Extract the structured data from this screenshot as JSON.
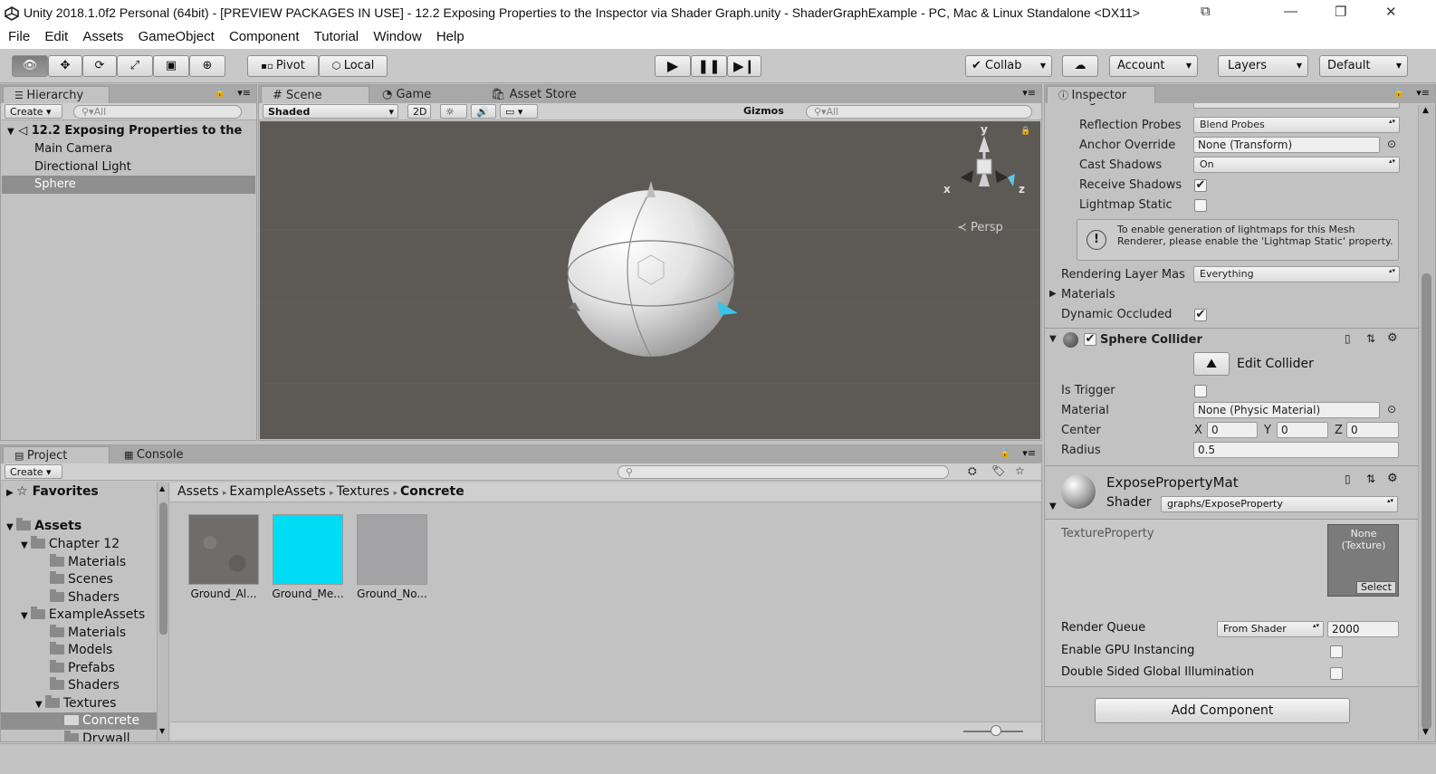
{
  "window": {
    "title": "Unity 2018.1.0f2 Personal (64bit) - [PREVIEW PACKAGES IN USE] - 12.2 Exposing Properties to the Inspector via Shader Graph.unity - ShaderGraphExample - PC, Mac & Linux Standalone <DX11>"
  },
  "menu": [
    "File",
    "Edit",
    "Assets",
    "GameObject",
    "Component",
    "Tutorial",
    "Window",
    "Help"
  ],
  "toolbar": {
    "pivot": "Pivot",
    "local": "Local",
    "collab": "Collab",
    "account": "Account",
    "layers": "Layers",
    "layout": "Default"
  },
  "hierarchy": {
    "tab": "Hierarchy",
    "create": "Create",
    "search_placeholder": "All",
    "scene": "12.2 Exposing Properties to the",
    "items": [
      "Main Camera",
      "Directional Light",
      "Sphere"
    ]
  },
  "scene": {
    "tabs": [
      "Scene",
      "Game",
      "Asset Store"
    ],
    "shading": "Shaded",
    "mode2d": "2D",
    "gizmos": "Gizmos",
    "search_placeholder": "All",
    "persp": "Persp",
    "axes": {
      "x": "x",
      "y": "y",
      "z": "z"
    }
  },
  "inspector": {
    "tab": "Inspector",
    "partial_top": "Light Probes",
    "partial_top_value": "Blend Probes",
    "reflection_probes": {
      "label": "Reflection Probes",
      "value": "Blend Probes"
    },
    "anchor_override": {
      "label": "Anchor Override",
      "value": "None (Transform)"
    },
    "cast_shadows": {
      "label": "Cast Shadows",
      "value": "On"
    },
    "receive_shadows": {
      "label": "Receive Shadows",
      "checked": true
    },
    "lightmap_static": {
      "label": "Lightmap Static",
      "checked": false
    },
    "info_message": "To enable generation of lightmaps for this Mesh Renderer, please enable the 'Lightmap Static' property.",
    "rendering_layer": {
      "label": "Rendering Layer Mas",
      "value": "Everything"
    },
    "materials_label": "Materials",
    "dynamic_occluded": {
      "label": "Dynamic Occluded",
      "checked": true
    },
    "sphere_collider": {
      "title": "Sphere Collider",
      "edit_collider": "Edit Collider",
      "is_trigger": "Is Trigger",
      "material_label": "Material",
      "material_value": "None (Physic Material)",
      "center_label": "Center",
      "center": {
        "x": "0",
        "y": "0",
        "z": "0"
      },
      "radius_label": "Radius",
      "radius": "0.5"
    },
    "material": {
      "name": "ExposePropertyMat",
      "shader_label": "Shader",
      "shader_value": "graphs/ExposeProperty",
      "texture_property": "TextureProperty",
      "texture_none": "None (Texture)",
      "texture_select": "Select",
      "render_queue_label": "Render Queue",
      "render_queue_mode": "From Shader",
      "render_queue_value": "2000",
      "gpu_instancing": "Enable GPU Instancing",
      "double_sided_gi": "Double Sided Global Illumination"
    },
    "add_component": "Add Component"
  },
  "project": {
    "tabs": [
      "Project",
      "Console"
    ],
    "create": "Create",
    "favorites": "Favorites",
    "tree": [
      {
        "label": "Assets",
        "bold": true
      },
      {
        "label": "Chapter 12"
      },
      {
        "label": "Materials"
      },
      {
        "label": "Scenes"
      },
      {
        "label": "Shaders"
      },
      {
        "label": "ExampleAssets"
      },
      {
        "label": "Materials"
      },
      {
        "label": "Models"
      },
      {
        "label": "Prefabs"
      },
      {
        "label": "Shaders"
      },
      {
        "label": "Textures"
      },
      {
        "label": "Concrete"
      },
      {
        "label": "Drywall"
      }
    ],
    "breadcrumb": [
      "Assets",
      "ExampleAssets",
      "Textures",
      "Concrete"
    ],
    "assets": [
      {
        "label": "Ground_Al...",
        "color": "#6f6c69"
      },
      {
        "label": "Ground_Me...",
        "color": "#00dcf4"
      },
      {
        "label": "Ground_No...",
        "color": "#a3a3a6"
      }
    ]
  },
  "colors": {
    "scene_bg": "#5d5954",
    "selection": "#8e8e8e",
    "metal_tint": "#00dcf4"
  }
}
